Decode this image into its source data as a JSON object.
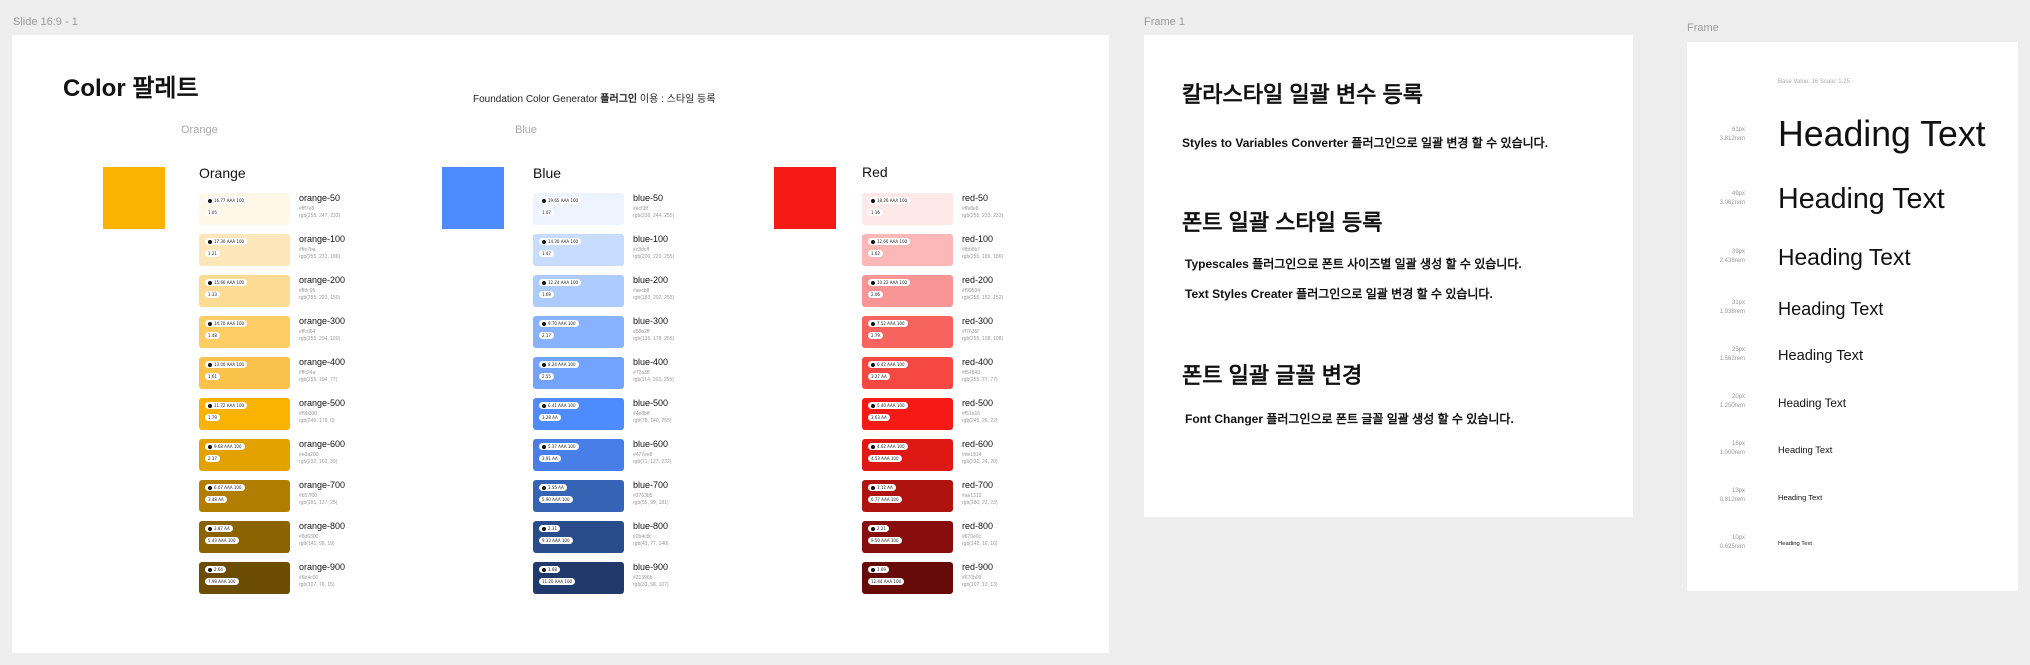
{
  "labels": {
    "slide": "Slide 16:9 - 1",
    "frame1": "Frame 1",
    "frame2": "Frame"
  },
  "slide": {
    "title": "Color 팔레트",
    "subtitle_pre": "Foundation Color Generator ",
    "subtitle_bold": "플러그인",
    "subtitle_post": " 이용 :  스타일 등록",
    "section_labels": [
      "Orange",
      "Blue"
    ]
  },
  "palettes": [
    {
      "name": "Orange",
      "swatch": "#F9B300",
      "shades": [
        {
          "name": "orange-50",
          "color": "#FFF7E8",
          "hex": "#fff7e8",
          "rgb": "rgb(255, 247, 233)",
          "p1": "16.77 AAA 100",
          "p2": "1.05",
          "dark": false
        },
        {
          "name": "orange-100",
          "color": "#FDE6BA",
          "hex": "#ffe7ba",
          "rgb": "rgb(255, 231, 186)",
          "p1": "17.30 AAA 100",
          "p2": "1.21",
          "dark": false
        },
        {
          "name": "orange-200",
          "color": "#FCDB95",
          "hex": "#ffdc95",
          "rgb": "rgb(255, 220, 150)",
          "p1": "15.66 AAA 100",
          "p2": "1.33",
          "dark": false
        },
        {
          "name": "orange-300",
          "color": "#FBCD64",
          "hex": "#ffcd64",
          "rgb": "rgb(255, 204, 100)",
          "p1": "14.70 AAA 100",
          "p2": "1.48",
          "dark": false
        },
        {
          "name": "orange-400",
          "color": "#FAC24A",
          "hex": "#ffc24a",
          "rgb": "rgb(255, 194, 77)",
          "p1": "13.00 AAA 100",
          "p2": "1.61",
          "dark": false
        },
        {
          "name": "orange-500",
          "color": "#F9B300",
          "hex": "#f9b300",
          "rgb": "rgb(249, 179, 0)",
          "p1": "11.72 AAA 100",
          "p2": "1.79",
          "dark": false
        },
        {
          "name": "orange-600",
          "color": "#E2A200",
          "hex": "#e8a200",
          "rgb": "rgb(232, 162, 39)",
          "p1": "9.68 AAA 100",
          "p2": "2.17",
          "dark": false
        },
        {
          "name": "orange-700",
          "color": "#B17E00",
          "hex": "#b57f00",
          "rgb": "rgb(181, 127, 25)",
          "p1": "6.07 AAA 100",
          "p2": "3.48 AA",
          "dark": true
        },
        {
          "name": "orange-800",
          "color": "#8B6300",
          "hex": "#8d6300",
          "rgb": "rgb(141, 99, 19)",
          "p1": "3.87 AA",
          "p2": "5.43 AAA 100",
          "dark": true
        },
        {
          "name": "orange-900",
          "color": "#6B4C00",
          "hex": "#6b4c00",
          "rgb": "rgb(107, 76, 15)",
          "p1": "2.64",
          "p2": "7.98 AAA 100",
          "dark": true
        }
      ]
    },
    {
      "name": "Blue",
      "swatch": "#4E8BFF",
      "shades": [
        {
          "name": "blue-50",
          "color": "#EEF4FF",
          "hex": "#ecf3ff",
          "rgb": "rgb(236, 244, 255)",
          "p1": "19.65 AAA 100",
          "p2": "1.07",
          "dark": false
        },
        {
          "name": "blue-100",
          "color": "#C8DCFF",
          "hex": "#c8dcff",
          "rgb": "rgb(200, 220, 255)",
          "p1": "14.30 AAA 100",
          "p2": "1.47",
          "dark": false
        },
        {
          "name": "blue-200",
          "color": "#AECBFF",
          "hex": "#aecbff",
          "rgb": "rgb(183, 202, 255)",
          "p1": "12.24 AAA 100",
          "p2": "1.69",
          "dark": false
        },
        {
          "name": "blue-300",
          "color": "#88B2FF",
          "hex": "#88b2ff",
          "rgb": "rgb(136, 178, 255)",
          "p1": "9.70 AAA 100",
          "p2": "2.17",
          "dark": false
        },
        {
          "name": "blue-400",
          "color": "#72A3FF",
          "hex": "#72a3ff",
          "rgb": "rgb(114, 163, 255)",
          "p1": "8.24 AAA 100",
          "p2": "2.55",
          "dark": false
        },
        {
          "name": "blue-500",
          "color": "#4E8BFF",
          "hex": "#4e8bff",
          "rgb": "rgb(78, 140, 255)",
          "p1": "6.41 AAA 100",
          "p2": "3.28 AA",
          "dark": false
        },
        {
          "name": "blue-600",
          "color": "#477EE8",
          "hex": "#477ee8",
          "rgb": "rgb(71, 127, 232)",
          "p1": "5.37 AAA 100",
          "p2": "3.91 AA",
          "dark": false
        },
        {
          "name": "blue-700",
          "color": "#3763B5",
          "hex": "#3763b5",
          "rgb": "rgb(55, 99, 181)",
          "p1": "3.55 AA",
          "p2": "5.90 AAA 100",
          "dark": true
        },
        {
          "name": "blue-800",
          "color": "#2B4C8C",
          "hex": "#2b4c8c",
          "rgb": "rgb(43, 77, 140)",
          "p1": "2.31",
          "p2": "9.33 AAA 100",
          "dark": true
        },
        {
          "name": "blue-900",
          "color": "#21396B",
          "hex": "#21396b",
          "rgb": "rgb(33, 58, 107)",
          "p1": "1.68",
          "p2": "11.20 AAA 100",
          "dark": true
        }
      ]
    },
    {
      "name": "Red",
      "swatch": "#F51A16",
      "shades": [
        {
          "name": "red-50",
          "color": "#FEE8E8",
          "hex": "#ffe8e8",
          "rgb": "rgb(255, 233, 233)",
          "p1": "18.26 AAA 100",
          "p2": "1.16",
          "dark": false
        },
        {
          "name": "red-100",
          "color": "#FBB8B7",
          "hex": "#fbb8b7",
          "rgb": "rgb(255, 186, 186)",
          "p1": "12.66 AAA 100",
          "p2": "1.62",
          "dark": false
        },
        {
          "name": "red-200",
          "color": "#F99594",
          "hex": "#f99594",
          "rgb": "rgb(255, 152, 152)",
          "p1": "10.22 AAA 100",
          "p2": "2.06",
          "dark": false
        },
        {
          "name": "red-300",
          "color": "#F7635F",
          "hex": "#f7635f",
          "rgb": "rgb(255, 108, 108)",
          "p1": "7.52 AAA 100",
          "p2": "2.79",
          "dark": false
        },
        {
          "name": "red-400",
          "color": "#F54843",
          "hex": "#f54843",
          "rgb": "rgb(255, 77, 77)",
          "p1": "6.42 AAA 100",
          "p2": "3.27 AA",
          "dark": false
        },
        {
          "name": "red-500",
          "color": "#F51A16",
          "hex": "#f51a16",
          "rgb": "rgb(245, 26, 22)",
          "p1": "5.40 AAA 100",
          "p2": "3.63 AA",
          "dark": false
        },
        {
          "name": "red-600",
          "color": "#DE1814",
          "hex": "#de1814",
          "rgb": "rgb(232, 24, 20)",
          "p1": "4.62 AAA 100",
          "p2": "4.53 AAA 100",
          "dark": true
        },
        {
          "name": "red-700",
          "color": "#AE1310",
          "hex": "#ae1310",
          "rgb": "rgb(180, 23, 23)",
          "p1": "3.12 AA",
          "p2": "6.77 AAA 100",
          "dark": true
        },
        {
          "name": "red-800",
          "color": "#870E0C",
          "hex": "#870e0c",
          "rgb": "rgb(142, 16, 16)",
          "p1": "2.21",
          "p2": "9.50 AAA 100",
          "dark": true
        },
        {
          "name": "red-900",
          "color": "#670B09",
          "hex": "#670b09",
          "rgb": "rgb(107, 13, 13)",
          "p1": "1.69",
          "p2": "12.44 AAA 100",
          "dark": true
        }
      ]
    }
  ],
  "frame1": {
    "h1": "칼라스타일 일괄 변수 등록",
    "p1": "Styles to Variables Converter 플러그인으로 일괄 변경 할 수 있습니다.",
    "h2": "폰트 일괄 스타일 등록",
    "p2": "Typescales 플러그인으로 폰트 사이즈별 일괄 생성 할 수 있습니다.",
    "p3": "Text Styles Creater 플러그인으로 일괄 변경 할 수 있습니다.",
    "h3": "폰트 일괄 글꼴 변경",
    "p4": "Font Changer 플러그인으로 폰트 글꼴 일괄 생성 할 수 있습니다."
  },
  "frame2": {
    "meta": "Base Value: 16    Scale: 1.25",
    "items": [
      {
        "px": "61px",
        "rem": "3.812rem",
        "text": "Heading Text",
        "size": 61
      },
      {
        "px": "49px",
        "rem": "3.062rem",
        "text": "Heading Text",
        "size": 49
      },
      {
        "px": "39px",
        "rem": "2.438rem",
        "text": "Heading Text",
        "size": 39
      },
      {
        "px": "31px",
        "rem": "1.938rem",
        "text": "Heading Text",
        "size": 31
      },
      {
        "px": "25px",
        "rem": "1.562rem",
        "text": "Heading Text",
        "size": 25
      },
      {
        "px": "20px",
        "rem": "1.250rem",
        "text": "Heading Text",
        "size": 20
      },
      {
        "px": "16px",
        "rem": "1.000rem",
        "text": "Heading Text",
        "size": 16
      },
      {
        "px": "13px",
        "rem": "0.812rem",
        "text": "Heading Text",
        "size": 13
      },
      {
        "px": "10px",
        "rem": "0.625rem",
        "text": "Heading Text",
        "size": 10
      }
    ]
  }
}
